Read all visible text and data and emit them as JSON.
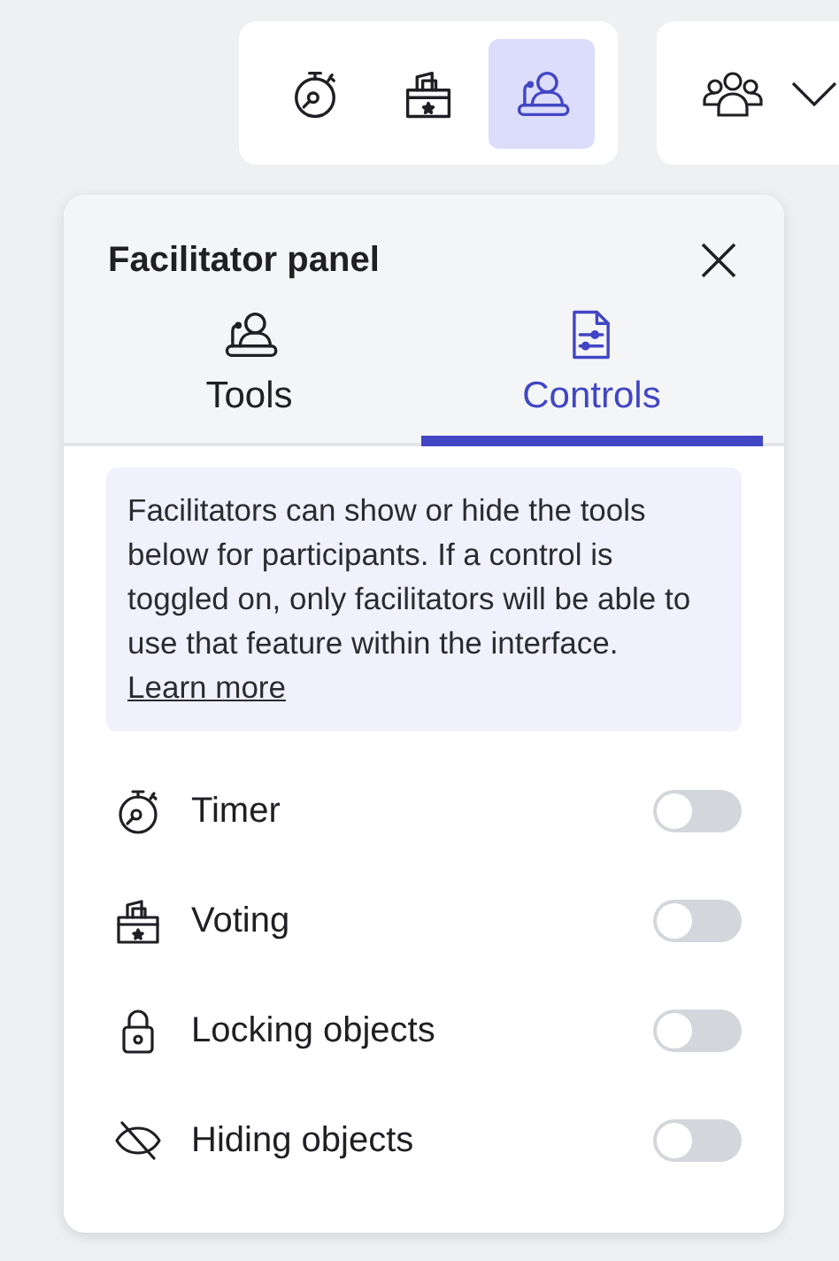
{
  "toolbar": {
    "items": [
      {
        "kind": "timer",
        "selected": false
      },
      {
        "kind": "voting",
        "selected": false
      },
      {
        "kind": "facilitator",
        "selected": true
      }
    ]
  },
  "participants_menu": {
    "expanded": false
  },
  "panel": {
    "title": "Facilitator panel",
    "tabs": [
      {
        "kind": "facilitator",
        "label": "Tools",
        "selected": false
      },
      {
        "kind": "controls",
        "label": "Controls",
        "selected": true
      }
    ],
    "info": {
      "text": "Facilitators can show or hide the tools below for participants. If a control is toggled on, only facilitators will be able to use that feature within the interface.",
      "link": "Learn more"
    },
    "controls": [
      {
        "kind": "timer",
        "label": "Timer",
        "on": false
      },
      {
        "kind": "voting",
        "label": "Voting",
        "on": false
      },
      {
        "kind": "lock",
        "label": "Locking objects",
        "on": false
      },
      {
        "kind": "hide",
        "label": "Hiding objects",
        "on": false
      }
    ]
  }
}
